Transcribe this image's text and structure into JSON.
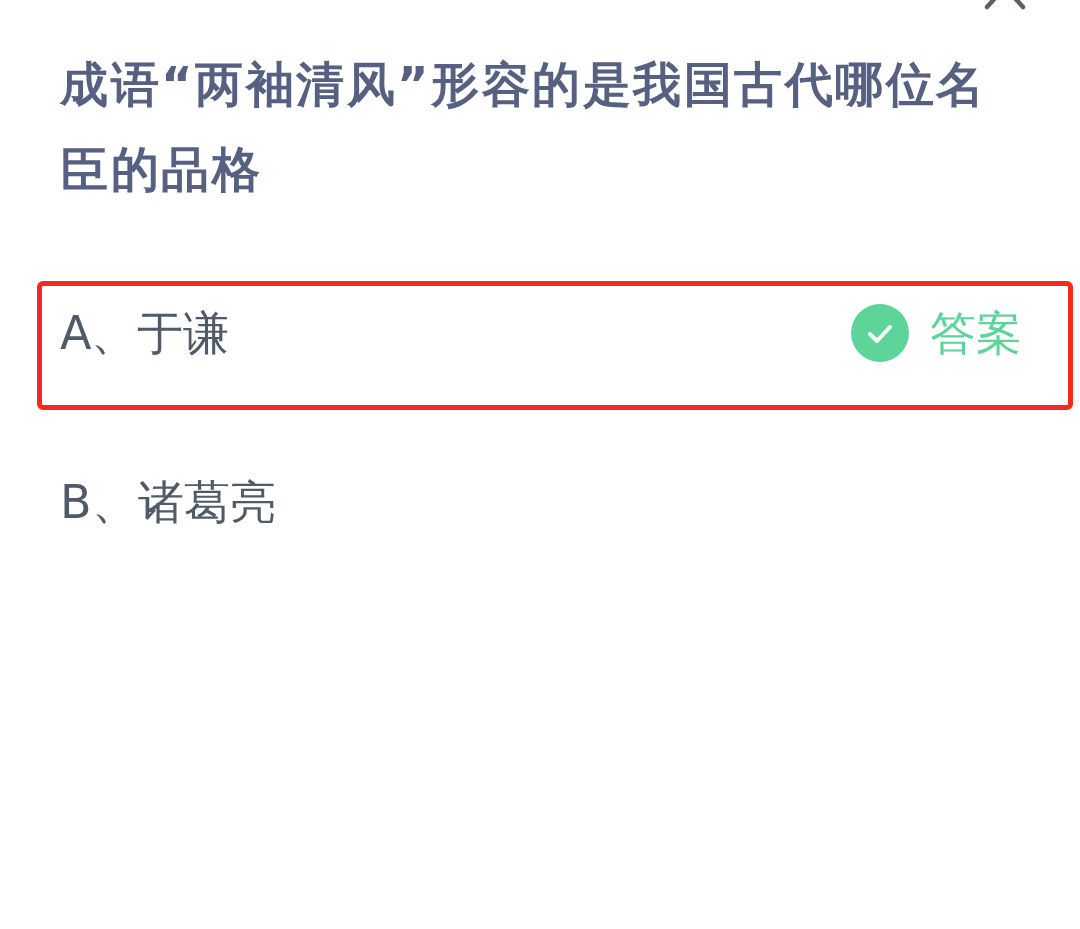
{
  "question": "成语“两袖清风”形容的是我国古代哪位名臣的品格",
  "options": [
    {
      "label": "A、于谦",
      "highlighted": true,
      "correct": true,
      "answer_tag": "答案"
    },
    {
      "label": "B、诸葛亮",
      "highlighted": false,
      "correct": false
    }
  ]
}
